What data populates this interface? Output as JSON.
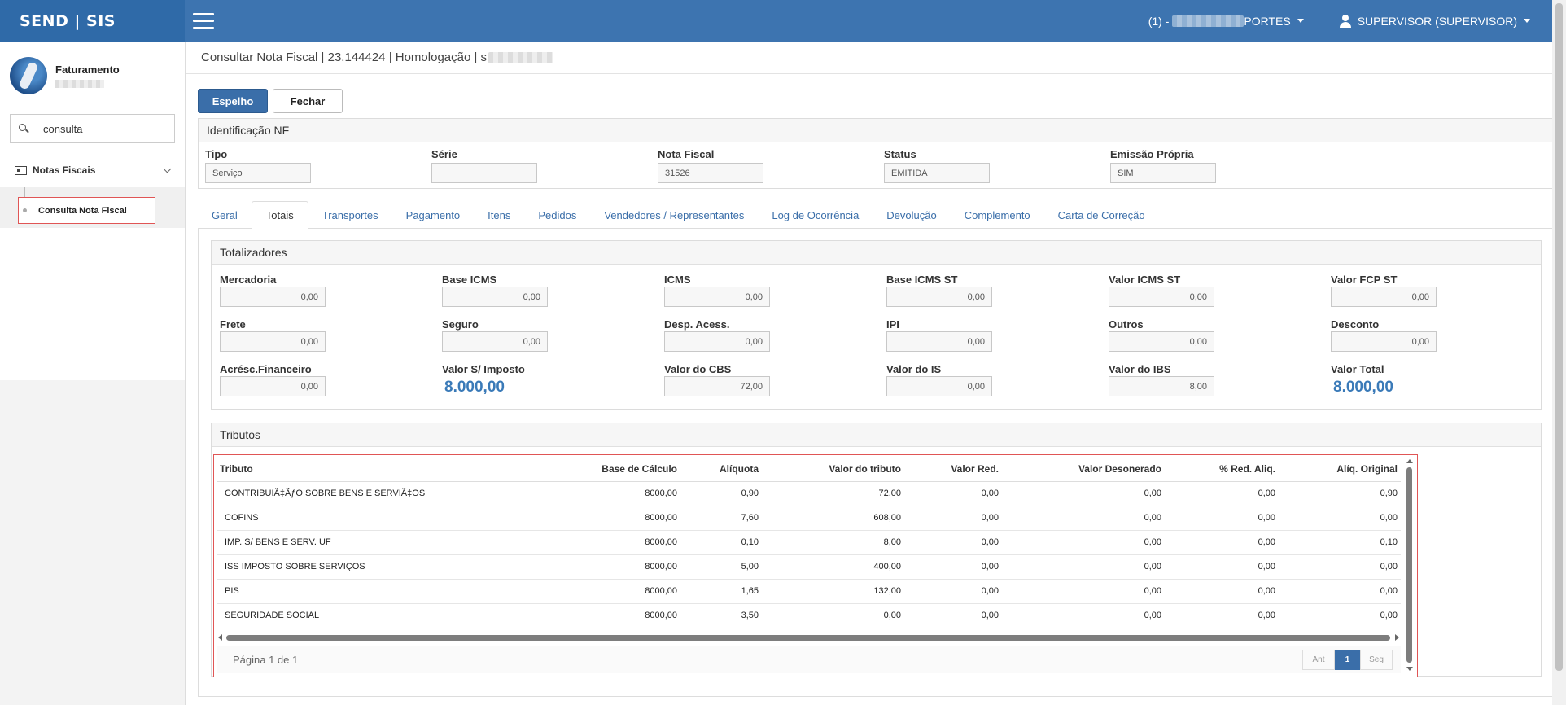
{
  "app": {
    "brand": "SEND | SIS",
    "company_prefix": "(1) -",
    "company_suffix": "PORTES",
    "user": "SUPERVISOR (SUPERVISOR)"
  },
  "sidebar": {
    "module_title": "Faturamento",
    "search_value": "consulta",
    "group_label": "Notas Fiscais",
    "item_label": "Consulta Nota Fiscal"
  },
  "page": {
    "title": "Consultar Nota Fiscal | 23.144424 | Homologação | s"
  },
  "buttons": {
    "espelho": "Espelho",
    "fechar": "Fechar"
  },
  "identificacao": {
    "heading": "Identificação NF",
    "fields": [
      {
        "label": "Tipo",
        "value": "Serviço"
      },
      {
        "label": "Série",
        "value": ""
      },
      {
        "label": "Nota Fiscal",
        "value": "31526"
      },
      {
        "label": "Status",
        "value": "EMITIDA"
      },
      {
        "label": "Emissão Própria",
        "value": "SIM"
      }
    ]
  },
  "tabs": [
    "Geral",
    "Totais",
    "Transportes",
    "Pagamento",
    "Itens",
    "Pedidos",
    "Vendedores / Representantes",
    "Log de Ocorrência",
    "Devolução",
    "Complemento",
    "Carta de Correção"
  ],
  "active_tab": "Totais",
  "totalizadores": {
    "heading": "Totalizadores",
    "rows": [
      [
        {
          "label": "Mercadoria",
          "value": "0,00"
        },
        {
          "label": "Base ICMS",
          "value": "0,00"
        },
        {
          "label": "ICMS",
          "value": "0,00"
        },
        {
          "label": "Base ICMS ST",
          "value": "0,00"
        },
        {
          "label": "Valor ICMS ST",
          "value": "0,00"
        },
        {
          "label": "Valor FCP ST",
          "value": "0,00"
        }
      ],
      [
        {
          "label": "Frete",
          "value": "0,00"
        },
        {
          "label": "Seguro",
          "value": "0,00"
        },
        {
          "label": "Desp. Acess.",
          "value": "0,00"
        },
        {
          "label": "IPI",
          "value": "0,00"
        },
        {
          "label": "Outros",
          "value": "0,00"
        },
        {
          "label": "Desconto",
          "value": "0,00"
        }
      ],
      [
        {
          "label": "Acrésc.Financeiro",
          "value": "0,00"
        },
        {
          "label": "Valor S/ Imposto",
          "value": "8.000,00",
          "big": true
        },
        {
          "label": "Valor do CBS",
          "value": "72,00"
        },
        {
          "label": "Valor do IS",
          "value": "0,00"
        },
        {
          "label": "Valor do IBS",
          "value": "8,00"
        },
        {
          "label": "Valor Total",
          "value": "8.000,00",
          "big": true
        }
      ]
    ]
  },
  "tributos": {
    "heading": "Tributos",
    "columns": [
      "Tributo",
      "Base de Cálculo",
      "Alíquota",
      "Valor do tributo",
      "Valor Red.",
      "Valor Desonerado",
      "% Red. Aliq.",
      "Alíq. Original"
    ],
    "rows": [
      [
        "CONTRIBUIÃ‡ÃƒO SOBRE BENS E SERVIÃ‡OS",
        "8000,00",
        "0,90",
        "72,00",
        "0,00",
        "0,00",
        "0,00",
        "0,90"
      ],
      [
        "COFINS",
        "8000,00",
        "7,60",
        "608,00",
        "0,00",
        "0,00",
        "0,00",
        "0,00"
      ],
      [
        "IMP. S/ BENS E SERV. UF",
        "8000,00",
        "0,10",
        "8,00",
        "0,00",
        "0,00",
        "0,00",
        "0,10"
      ],
      [
        "ISS IMPOSTO SOBRE SERVIÇOS",
        "8000,00",
        "5,00",
        "400,00",
        "0,00",
        "0,00",
        "0,00",
        "0,00"
      ],
      [
        "PIS",
        "8000,00",
        "1,65",
        "132,00",
        "0,00",
        "0,00",
        "0,00",
        "0,00"
      ],
      [
        "SEGURIDADE SOCIAL",
        "8000,00",
        "3,50",
        "0,00",
        "0,00",
        "0,00",
        "0,00",
        "0,00"
      ]
    ],
    "pager_text": "Página 1 de 1",
    "pager": {
      "prev": "Ant",
      "current": "1",
      "next": "Seg"
    }
  },
  "colors": {
    "topbar": "#3d74b0",
    "accent": "#3a6ea9",
    "highlight": "#e05555"
  }
}
